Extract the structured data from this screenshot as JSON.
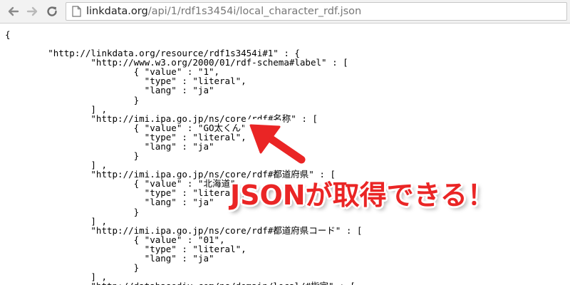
{
  "browser": {
    "url_host": "linkdata.org",
    "url_path": "/api/1/rdf1s3454i/local_character_rdf.json"
  },
  "json_lines": [
    "{",
    "",
    "        \"http://linkdata.org/resource/rdf1s3454i#1\" : {",
    "                \"http://www.w3.org/2000/01/rdf-schema#label\" : [",
    "                        { \"value\" : \"1\",",
    "                          \"type\" : \"literal\",",
    "                          \"lang\" : \"ja\"",
    "                        }",
    "                ] ,",
    "                \"http://imi.ipa.go.jp/ns/core/rdf#名称\" : [",
    "                        { \"value\" : \"GO太くん\",",
    "                          \"type\" : \"literal\",",
    "                          \"lang\" : \"ja\"",
    "                        }",
    "                ] ,",
    "                \"http://imi.ipa.go.jp/ns/core/rdf#都道府県\" : [",
    "                        { \"value\" : \"北海道\",",
    "                          \"type\" : \"literal\",",
    "                          \"lang\" : \"ja\"",
    "                        }",
    "                ] ,",
    "                \"http://imi.ipa.go.jp/ns/core/rdf#都道府県コード\" : [",
    "                        { \"value\" : \"01\",",
    "                          \"type\" : \"literal\",",
    "                          \"lang\" : \"ja\"",
    "                        }",
    "                ] ,",
    "                \"http://databasediv.com/ns/domain/local/#指定\" : ["
  ],
  "annotation": {
    "text": "JSONが取得できる！",
    "color": "#ea2525"
  }
}
